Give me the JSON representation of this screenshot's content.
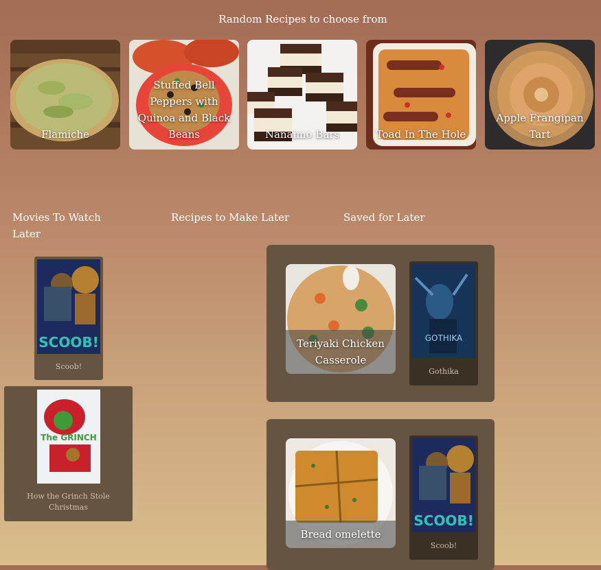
{
  "header": {
    "title": "Random Recipes to choose from"
  },
  "random_recipes": [
    {
      "name": "Flamiche"
    },
    {
      "name": "Stuffed Bell Peppers with Quinoa and Black Beans"
    },
    {
      "name": "Nanaimo Bars"
    },
    {
      "name": "Toad In The Hole"
    },
    {
      "name": "Apple Frangipan Tart"
    }
  ],
  "sections": {
    "movies": {
      "heading": "Movies To Watch Later"
    },
    "recipes": {
      "heading": "Recipes to Make Later"
    },
    "saved": {
      "heading": "Saved for Later"
    }
  },
  "movies_to_watch": [
    {
      "title": "Scoob!",
      "poster_text": "SCOOB!"
    },
    {
      "title": "How the Grinch Stole Christmas",
      "poster_text": "The GRINCH"
    }
  ],
  "saved_for_later": [
    {
      "recipe": "Teriyaki Chicken Casserole",
      "movie": "Gothika",
      "movie_poster_text": "GOTHIKA"
    },
    {
      "recipe": "Bread omelette",
      "movie": "Scoob!",
      "movie_poster_text": "SCOOB!"
    }
  ],
  "colors": {
    "page_top": "#a36c55",
    "page_bottom": "#d9be8b",
    "panel": "#665442",
    "card_dark": "#3b3024"
  }
}
